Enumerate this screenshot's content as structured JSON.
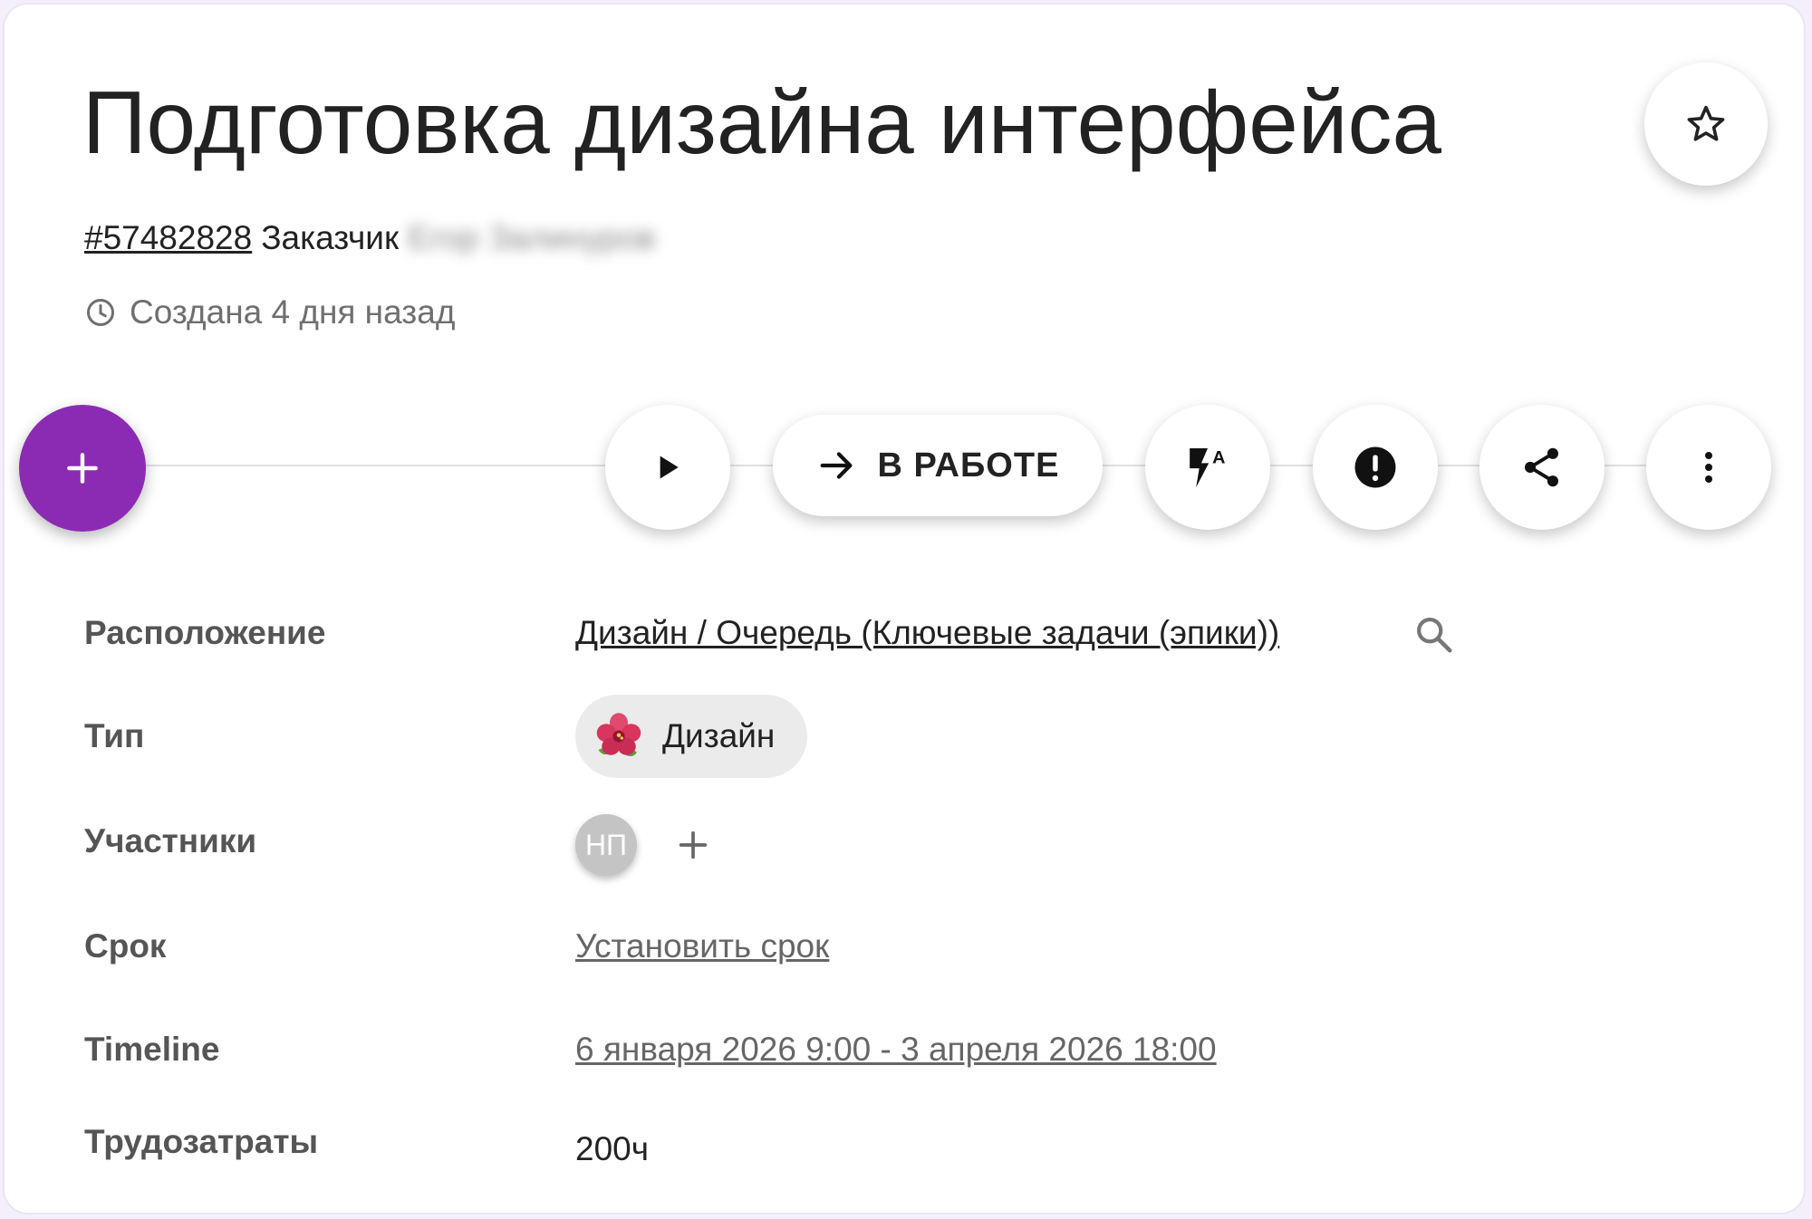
{
  "task": {
    "title": "Подготовка дизайна интерфейса",
    "id": "#57482828",
    "customer_label": "Заказчик",
    "customer_name": "Егор Залинуров",
    "created": "Создана 4 дня назад"
  },
  "toolbar": {
    "add_icon": "plus-icon",
    "play_icon": "play-icon",
    "status_label": "В РАБОТЕ",
    "status_icon": "arrow-right-icon",
    "auto_icon": "flash-auto-icon",
    "priority_icon": "exclamation-circle-icon",
    "share_icon": "share-icon",
    "more_icon": "more-vertical-icon",
    "favorite_icon": "star-outline-icon",
    "accent_color": "#8b2bb3"
  },
  "properties": {
    "location": {
      "label": "Расположение",
      "value": "Дизайн / Очередь (Ключевые задачи (эпики))"
    },
    "type": {
      "label": "Тип",
      "value": "Дизайн",
      "icon": "hibiscus-icon"
    },
    "members": {
      "label": "Участники",
      "avatar": "НП"
    },
    "deadline": {
      "label": "Срок",
      "value": "Установить срок"
    },
    "timeline": {
      "label": "Timeline",
      "value": "6 января 2026 9:00 - 3 апреля 2026 18:00"
    },
    "effort": {
      "label": "Трудозатраты",
      "value": "200ч"
    }
  }
}
